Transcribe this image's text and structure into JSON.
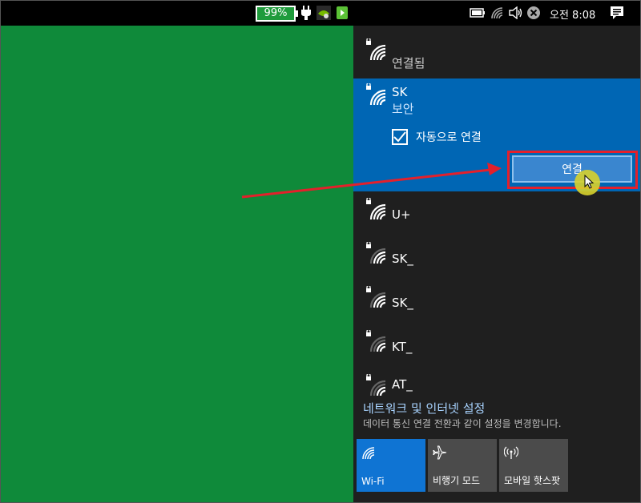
{
  "taskbar": {
    "battery_percent": "99%",
    "clock": "오전 8:08"
  },
  "panel": {
    "connected_network": {
      "name": "",
      "status": "연결됨"
    },
    "selected_network": {
      "name": "SK",
      "status": "보안",
      "auto_connect_label": "자동으로 연결",
      "auto_connect_checked": true,
      "connect_button": "연결"
    },
    "networks": [
      {
        "name": "U+"
      },
      {
        "name": "SK_"
      },
      {
        "name": "SK_"
      },
      {
        "name": "KT_"
      },
      {
        "name": "AT_"
      }
    ],
    "settings_link": "네트워크 및 인터넷 설정",
    "settings_desc": "데이터 통신 연결 전환과 같이 설정을 변경합니다.",
    "tiles": [
      {
        "label": "Wi-Fi",
        "icon": "wifi-icon",
        "active": true
      },
      {
        "label": "비행기 모드",
        "icon": "airplane-icon",
        "active": false
      },
      {
        "label": "모바일 핫스팟",
        "icon": "hotspot-icon",
        "active": false
      }
    ]
  },
  "colors": {
    "desktop": "#0f8a3a",
    "panel": "#1f1f1f",
    "accent": "#0066b4",
    "highlight": "#e4202b"
  }
}
